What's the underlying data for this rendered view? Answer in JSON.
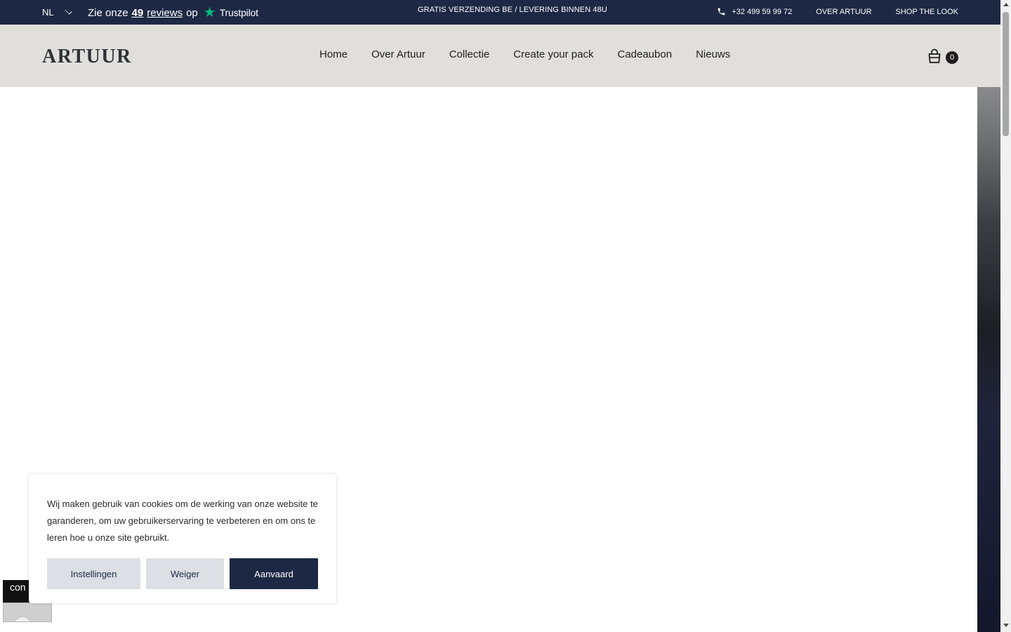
{
  "topbar": {
    "language": "NL",
    "trustpilot_prefix": "Zie onze",
    "review_count": "49",
    "review_word": "reviews",
    "trustpilot_suffix": "op",
    "trustpilot_brand": "Trustpilot",
    "shipping_notice": "GRATIS VERZENDING BE / LEVERING BINNEN 48U",
    "phone": "+32 499 59 99 72",
    "links": [
      "OVER ARTUUR",
      "SHOP THE LOOK"
    ]
  },
  "header": {
    "logo": "ARTUUR",
    "nav": [
      "Home",
      "Over Artuur",
      "Collectie",
      "Create your pack",
      "Cadeaubon",
      "Nieuws"
    ],
    "cart_count": "0"
  },
  "cookie_banner": {
    "text": "Wij maken gebruik van cookies om de werking van onze website te garanderen, om uw gebruikerservaring te verbeteren en om ons te leren hoe u onze site gebruikt.",
    "settings_label": "Instellingen",
    "decline_label": "Weiger",
    "accept_label": "Aanvaard"
  },
  "widget": {
    "label": "con"
  },
  "colors": {
    "navy": "#1d2944",
    "header_bg": "#e1dfdb",
    "trustpilot_green": "#00b67a"
  }
}
